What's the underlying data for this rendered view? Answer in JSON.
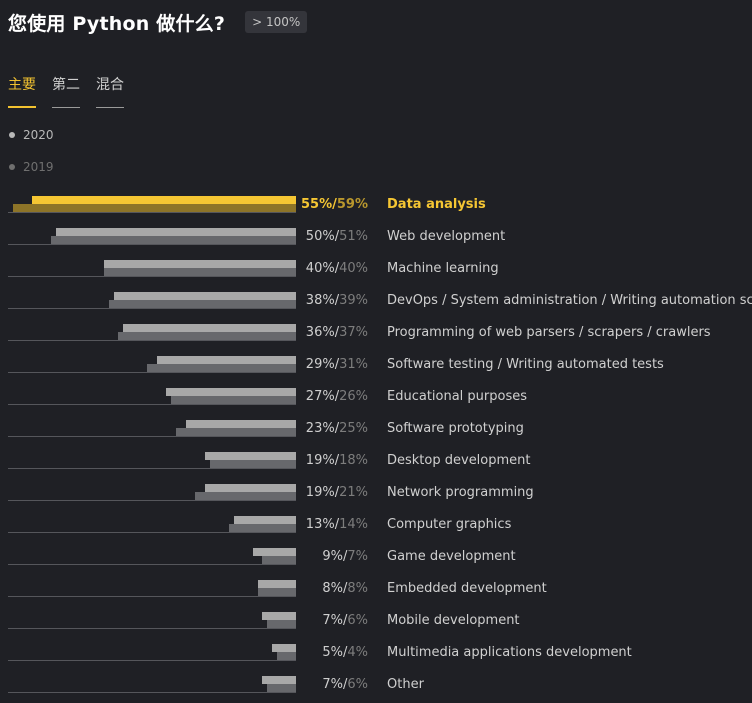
{
  "header": {
    "title": "您使用 Python 做什么?",
    "badge": "> 100%"
  },
  "tabs": [
    {
      "label": "主要",
      "active": true
    },
    {
      "label": "第二",
      "active": false
    },
    {
      "label": "混合",
      "active": false
    }
  ],
  "legend": {
    "series_a": "2020",
    "series_b": "2019"
  },
  "colors": {
    "accent": "#f5c633",
    "bar_2020": "#a8a8a8",
    "bar_2019": "#67686c",
    "background": "#1f2025"
  },
  "chart_data": {
    "type": "bar",
    "orientation": "horizontal",
    "title": "您使用 Python 做什么?",
    "xlim": [
      0,
      60
    ],
    "grid": false,
    "legend_position": "top-left",
    "categories": [
      "Data analysis",
      "Web development",
      "Machine learning",
      "DevOps / System administration / Writing automation scripts",
      "Programming of web parsers / scrapers / crawlers",
      "Software testing / Writing automated tests",
      "Educational purposes",
      "Software prototyping",
      "Desktop development",
      "Network programming",
      "Computer graphics",
      "Game development",
      "Embedded development",
      "Mobile development",
      "Multimedia applications development",
      "Other"
    ],
    "series": [
      {
        "name": "2020",
        "values": [
          55,
          50,
          40,
          38,
          36,
          29,
          27,
          23,
          19,
          19,
          13,
          9,
          8,
          7,
          5,
          7
        ]
      },
      {
        "name": "2019",
        "values": [
          59,
          51,
          40,
          39,
          37,
          31,
          26,
          25,
          18,
          21,
          14,
          7,
          8,
          6,
          4,
          6
        ]
      }
    ],
    "highlight_index": 0
  }
}
